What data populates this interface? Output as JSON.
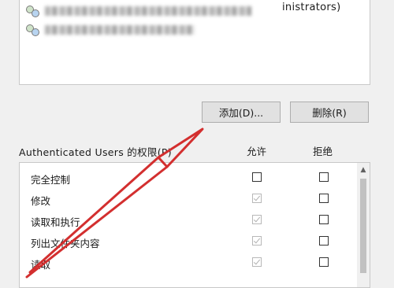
{
  "group_list": {
    "rows": [
      {
        "icon": "users-icon",
        "redacted": true,
        "suffix": "inistrators)"
      },
      {
        "icon": "users-icon",
        "redacted": true,
        "suffix": ""
      }
    ]
  },
  "buttons": {
    "add_label": "添加(D)...",
    "remove_label": "删除(R)"
  },
  "permissions": {
    "label": "Authenticated Users 的权限(P)",
    "allow_header": "允许",
    "deny_header": "拒绝",
    "items": [
      {
        "name": "完全控制",
        "allow": false,
        "allow_dim": false,
        "deny": false
      },
      {
        "name": "修改",
        "allow": true,
        "allow_dim": true,
        "deny": false
      },
      {
        "name": "读取和执行",
        "allow": true,
        "allow_dim": true,
        "deny": false
      },
      {
        "name": "列出文件夹内容",
        "allow": true,
        "allow_dim": true,
        "deny": false
      },
      {
        "name": "读取",
        "allow": true,
        "allow_dim": true,
        "deny": false
      }
    ]
  },
  "annotation": {
    "color": "#d32f2f",
    "icon": "red-arrow-annotation"
  }
}
